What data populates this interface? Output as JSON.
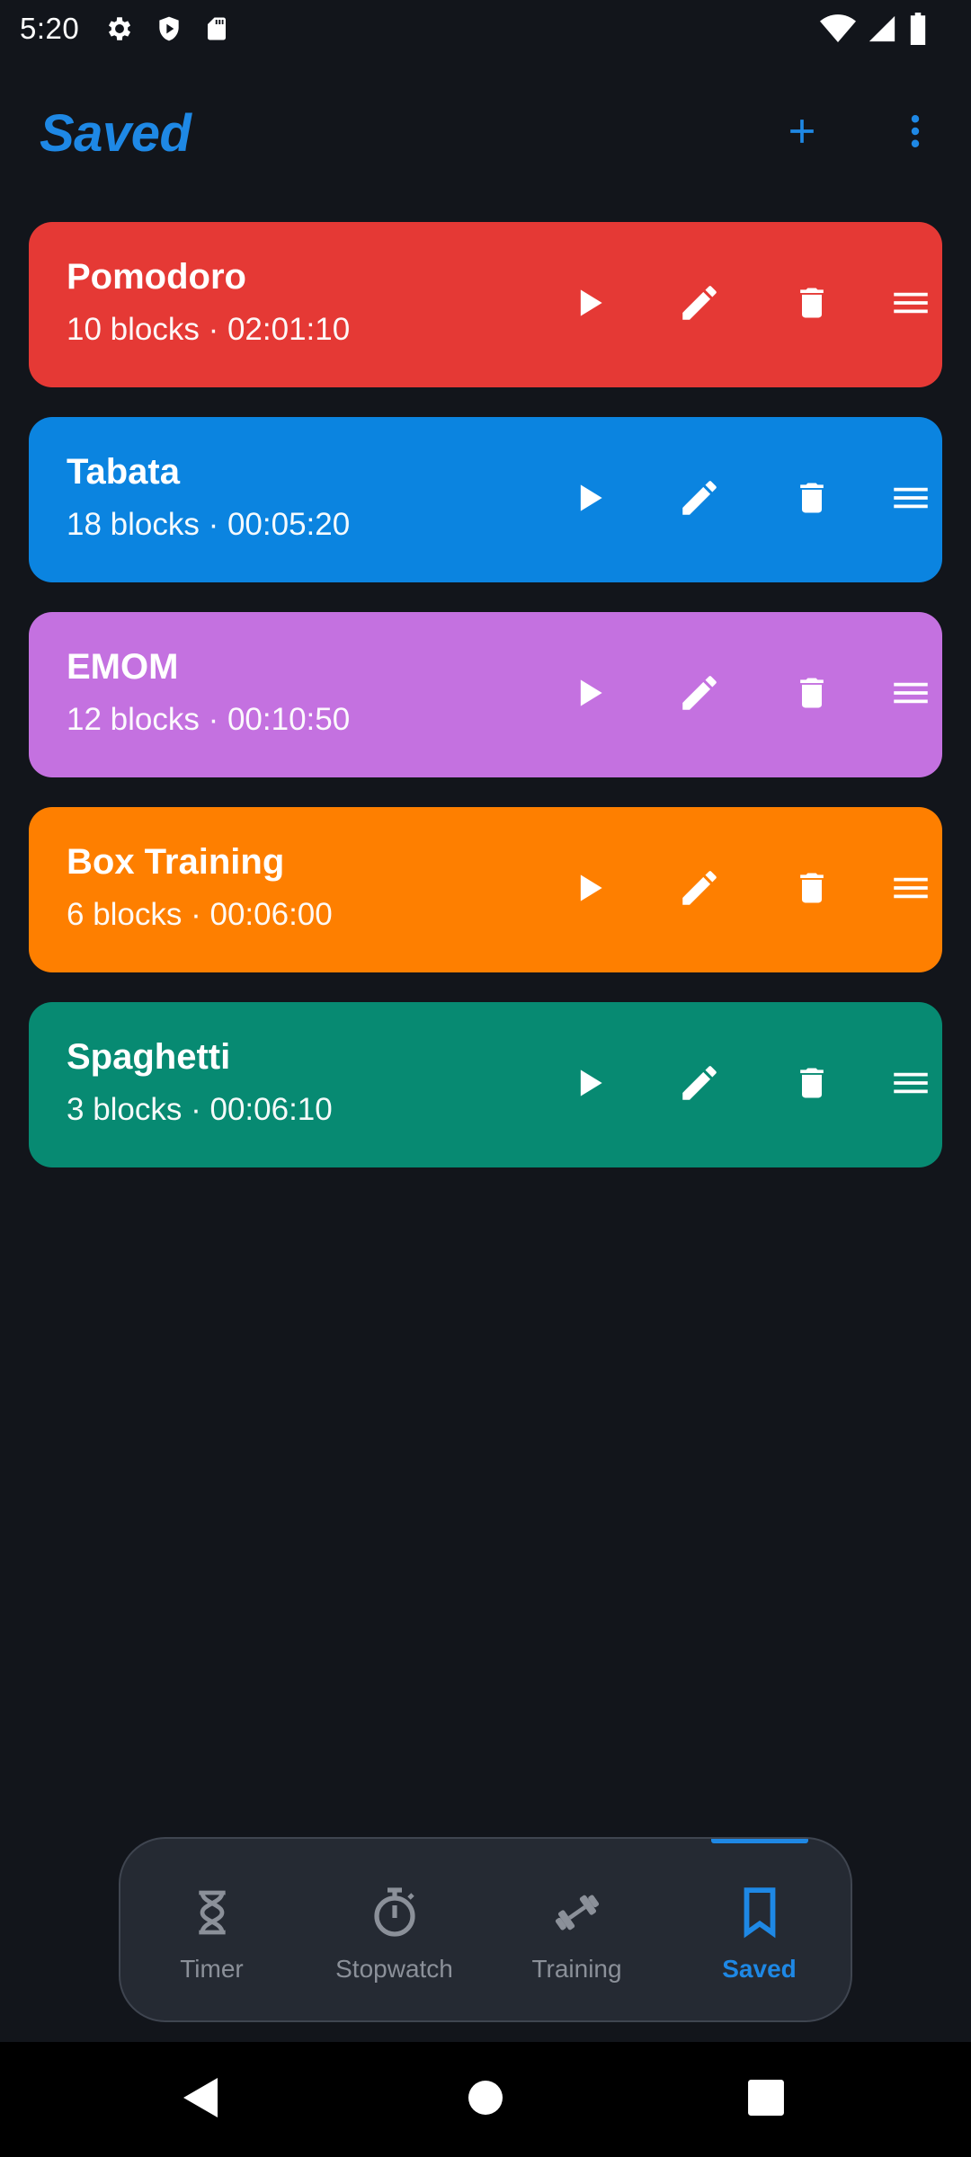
{
  "status_bar": {
    "time": "5:20",
    "left_icons": [
      "settings-gear-icon",
      "shield-play-icon",
      "sd-card-icon"
    ],
    "right_icons": [
      "wifi-icon",
      "cell-signal-icon",
      "battery-icon"
    ]
  },
  "app_bar": {
    "title": "Saved",
    "actions": [
      "add-icon",
      "more-vert-icon"
    ]
  },
  "accent_color": "#1e88e5",
  "presets": [
    {
      "name": "Pomodoro",
      "meta": "10 blocks · 02:01:10",
      "color": "#e53935"
    },
    {
      "name": "Tabata",
      "meta": "18 blocks · 00:05:20",
      "color": "#0b84e0"
    },
    {
      "name": "EMOM",
      "meta": "12 blocks · 00:10:50",
      "color": "#c471e0"
    },
    {
      "name": "Box Training",
      "meta": "6 blocks · 00:06:00",
      "color": "#fe7f00"
    },
    {
      "name": "Spaghetti",
      "meta": "3 blocks · 00:06:10",
      "color": "#078a72"
    }
  ],
  "card_actions": [
    "play-icon",
    "edit-pencil-icon",
    "delete-trash-icon",
    "drag-handle-icon"
  ],
  "bottom_nav": {
    "items": [
      {
        "label": "Timer",
        "icon": "hourglass-icon"
      },
      {
        "label": "Stopwatch",
        "icon": "stopwatch-icon"
      },
      {
        "label": "Training",
        "icon": "dumbbell-icon"
      },
      {
        "label": "Saved",
        "icon": "bookmark-icon"
      }
    ],
    "active": "Saved"
  },
  "system_nav": [
    "back-icon",
    "home-icon",
    "recents-icon"
  ]
}
